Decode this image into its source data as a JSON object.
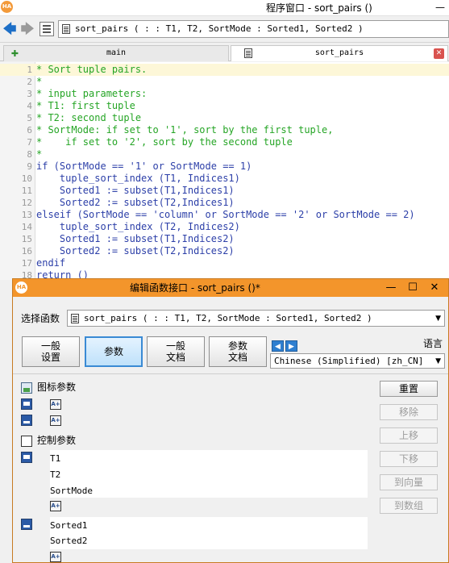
{
  "main_window": {
    "title": "程序窗口 - sort_pairs ()",
    "logo": "HA",
    "minimize": "—",
    "toolbar": {
      "back_icon": "🡄",
      "forward_icon": "🡆",
      "procedure_signature": "sort_pairs ( : : T1, T2, SortMode : Sorted1, Sorted2 )"
    },
    "tabs": [
      {
        "label": "main",
        "icon": "✚"
      },
      {
        "label": "sort_pairs",
        "close": "✕"
      }
    ],
    "code_lines": [
      {
        "num": "1",
        "text": "* Sort tuple pairs.",
        "kind": "comment"
      },
      {
        "num": "2",
        "text": "*",
        "kind": "comment"
      },
      {
        "num": "3",
        "text": "* input parameters:",
        "kind": "comment"
      },
      {
        "num": "4",
        "text": "* T1: first tuple",
        "kind": "comment"
      },
      {
        "num": "5",
        "text": "* T2: second tuple",
        "kind": "comment"
      },
      {
        "num": "6",
        "text": "* SortMode: if set to '1', sort by the first tuple,",
        "kind": "comment"
      },
      {
        "num": "7",
        "text": "*    if set to '2', sort by the second tuple",
        "kind": "comment"
      },
      {
        "num": "8",
        "text": "*",
        "kind": "comment"
      },
      {
        "num": "9",
        "text": "if (SortMode == '1' or SortMode == 1)",
        "kind": "code"
      },
      {
        "num": "10",
        "text": "    tuple_sort_index (T1, Indices1)",
        "kind": "code"
      },
      {
        "num": "11",
        "text": "    Sorted1 := subset(T1,Indices1)",
        "kind": "code"
      },
      {
        "num": "12",
        "text": "    Sorted2 := subset(T2,Indices1)",
        "kind": "code"
      },
      {
        "num": "13",
        "text": "elseif (SortMode == 'column' or SortMode == '2' or SortMode == 2)",
        "kind": "code"
      },
      {
        "num": "14",
        "text": "    tuple_sort_index (T2, Indices2)",
        "kind": "code"
      },
      {
        "num": "15",
        "text": "    Sorted1 := subset(T1,Indices2)",
        "kind": "code"
      },
      {
        "num": "16",
        "text": "    Sorted2 := subset(T2,Indices2)",
        "kind": "code"
      },
      {
        "num": "17",
        "text": "endif",
        "kind": "code"
      },
      {
        "num": "18",
        "text": "return ()",
        "kind": "code"
      }
    ]
  },
  "dialog": {
    "title": "编辑函数接口 - sort_pairs ()*",
    "logo": "HA",
    "minimize": "—",
    "maximize": "☐",
    "close": "✕",
    "select_label": "选择函数",
    "select_value": "sort_pairs ( : : T1, T2, SortMode : Sorted1, Sorted2 )",
    "dropdown_arrow": "▼",
    "category_buttons": [
      "一般\n设置",
      "参数",
      "一般\n文档",
      "参数\n文档"
    ],
    "language_label": "语言",
    "language_arrows": [
      "◀",
      "▶"
    ],
    "language_value": "Chinese (Simplified) [zh_CN]",
    "sections": {
      "iconic": "图标参数",
      "control": "控制参数"
    },
    "iconic_placeholder": "A+",
    "control_inputs": [
      "T1",
      "T2",
      "SortMode"
    ],
    "control_outputs": [
      "Sorted1",
      "Sorted2"
    ],
    "side_buttons": [
      {
        "label": "重置",
        "enabled": true
      },
      {
        "label": "移除",
        "enabled": false
      },
      {
        "label": "上移",
        "enabled": false
      },
      {
        "label": "下移",
        "enabled": false
      },
      {
        "label": "到向量",
        "enabled": false
      },
      {
        "label": "到数组",
        "enabled": false
      }
    ]
  },
  "colors": {
    "dialog_title": "#f3952b",
    "comment": "#25a525",
    "code": "#2c3fa8"
  }
}
